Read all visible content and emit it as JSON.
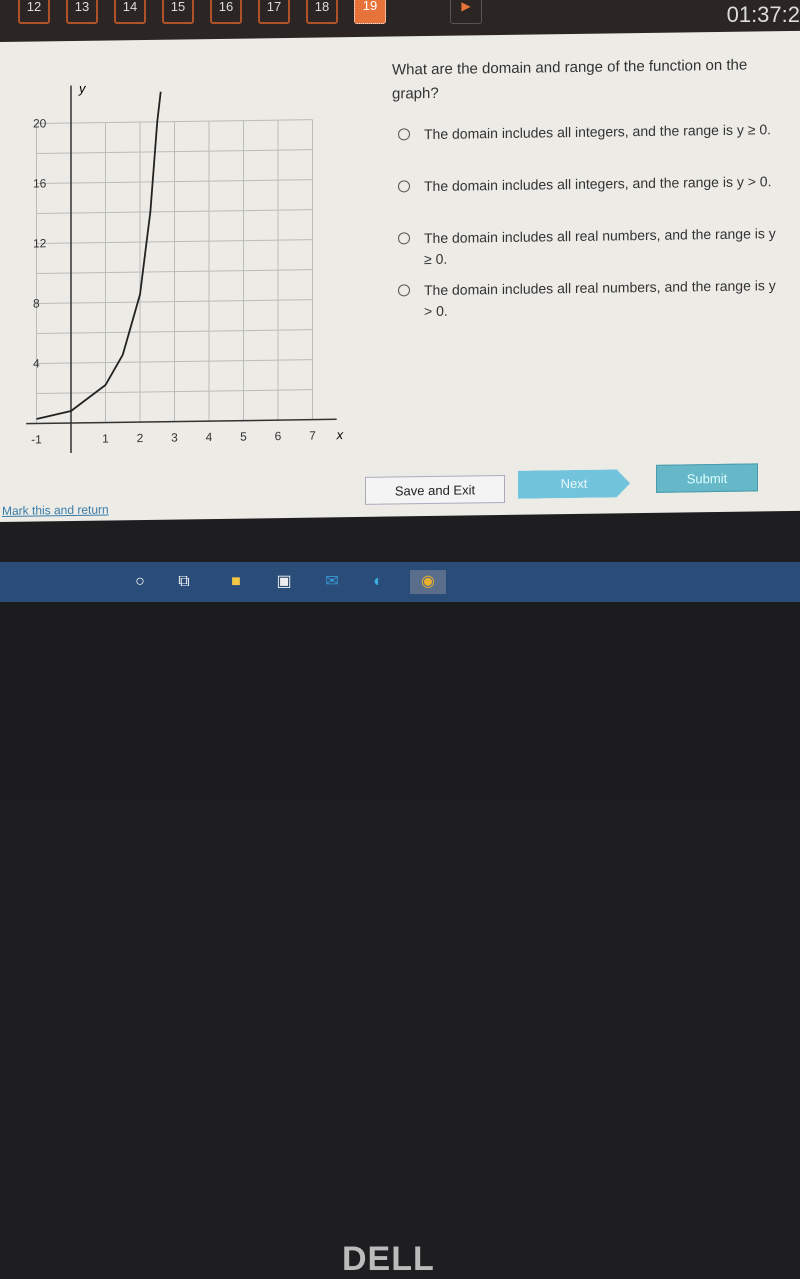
{
  "topbar": {
    "questions": [
      "12",
      "13",
      "14",
      "15",
      "16",
      "17",
      "18",
      "19"
    ],
    "active": "19",
    "timer": "01:37:2"
  },
  "question": {
    "text": "What are the domain and range of the function on the graph?",
    "options": [
      "The domain includes all integers, and the range is y ≥ 0.",
      "The domain includes all integers, and the range is y > 0.",
      "The domain includes all real numbers, and the range is y ≥ 0.",
      "The domain includes all real numbers, and the range is y > 0."
    ]
  },
  "buttons": {
    "save": "Save and Exit",
    "next": "Next",
    "submit": "Submit",
    "mark": "Mark this and return"
  },
  "taskbar": {
    "icons": [
      "cortana-icon",
      "task-view-icon",
      "file-explorer-icon",
      "store-icon",
      "mail-icon",
      "edge-icon",
      "chrome-icon"
    ]
  },
  "laptop": {
    "brand": "DELL"
  },
  "chart_data": {
    "type": "line",
    "xlabel": "x",
    "ylabel": "y",
    "xlim": [
      -1,
      7
    ],
    "ylim": [
      0,
      20
    ],
    "x_ticks": [
      "-1",
      "1",
      "2",
      "3",
      "4",
      "5",
      "6",
      "7"
    ],
    "y_ticks": [
      "4",
      "8",
      "12",
      "16",
      "20"
    ],
    "grid": true,
    "points": [
      [
        -1,
        0.3
      ],
      [
        0,
        0.8
      ],
      [
        1,
        2.5
      ],
      [
        1.5,
        4.5
      ],
      [
        2,
        8.5
      ],
      [
        2.3,
        14
      ],
      [
        2.5,
        20
      ],
      [
        2.6,
        22
      ]
    ]
  },
  "colors": {
    "active_question": "#e8733a",
    "next": "#72c4dc",
    "submit": "#66b8c8"
  }
}
